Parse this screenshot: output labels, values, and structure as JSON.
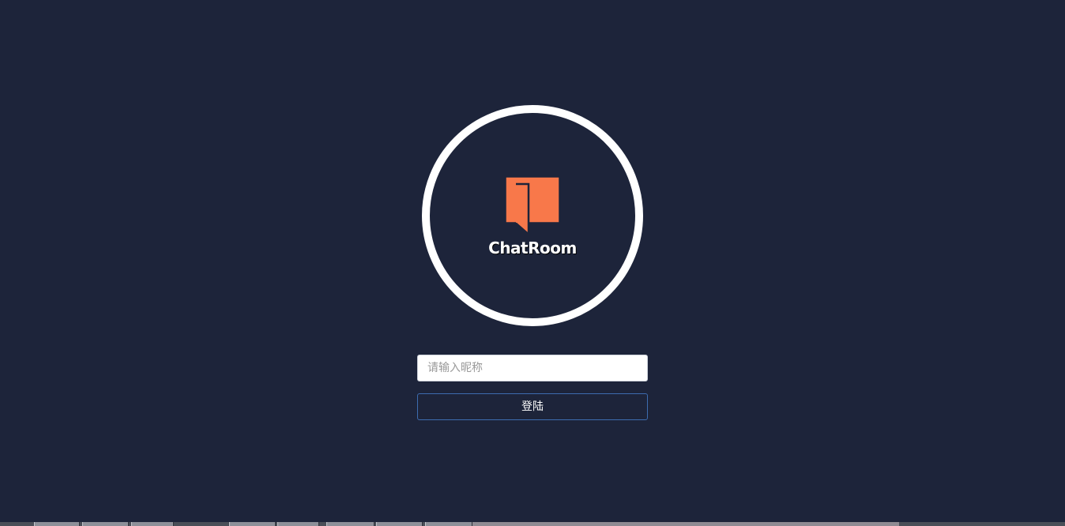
{
  "app": {
    "logo_text": "ChatRoom",
    "logo_icon": "chat-bubble-icon"
  },
  "login": {
    "nickname_placeholder": "请输入昵称",
    "nickname_value": "",
    "submit_label": "登陆"
  },
  "colors": {
    "background": "#1d243a",
    "brand_orange": "#f8784a",
    "button_border": "#3d6cb0",
    "ring": "#ffffff"
  }
}
